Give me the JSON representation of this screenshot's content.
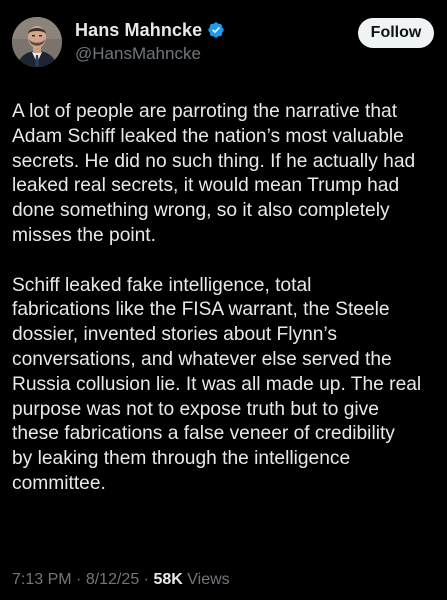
{
  "author": {
    "display_name": "Hans Mahncke",
    "handle": "@HansMahncke",
    "verified_icon": "verified-badge-icon",
    "verified_color": "#1d9bf0"
  },
  "follow_label": "Follow",
  "post": {
    "paragraph_1": "A lot of people are parroting the narrative that\nAdam Schiff leaked the nation’s most valuable\nsecrets. He did no such thing. If he actually had\nleaked real secrets, it would mean Trump had\ndone something wrong, so it also completely\nmisses the point.",
    "paragraph_2": "Schiff leaked fake intelligence, total\nfabrications like the FISA warrant, the Steele\ndossier, invented stories about Flynn’s\nconversations, and whatever else served the\nRussia collusion lie. It was all made up. The real\npurpose was not to expose truth but to give\nthese fabrications a false veneer of credibility\nby leaking them through the intelligence\ncommittee."
  },
  "meta": {
    "time": "7:13 PM",
    "separator": "·",
    "date": "8/12/25",
    "views_count": "58K",
    "views_label": "Views"
  },
  "colors": {
    "background": "#000000",
    "text_primary": "#e7e9ea",
    "text_secondary": "#71767b",
    "button_bg": "#eff3f4"
  }
}
